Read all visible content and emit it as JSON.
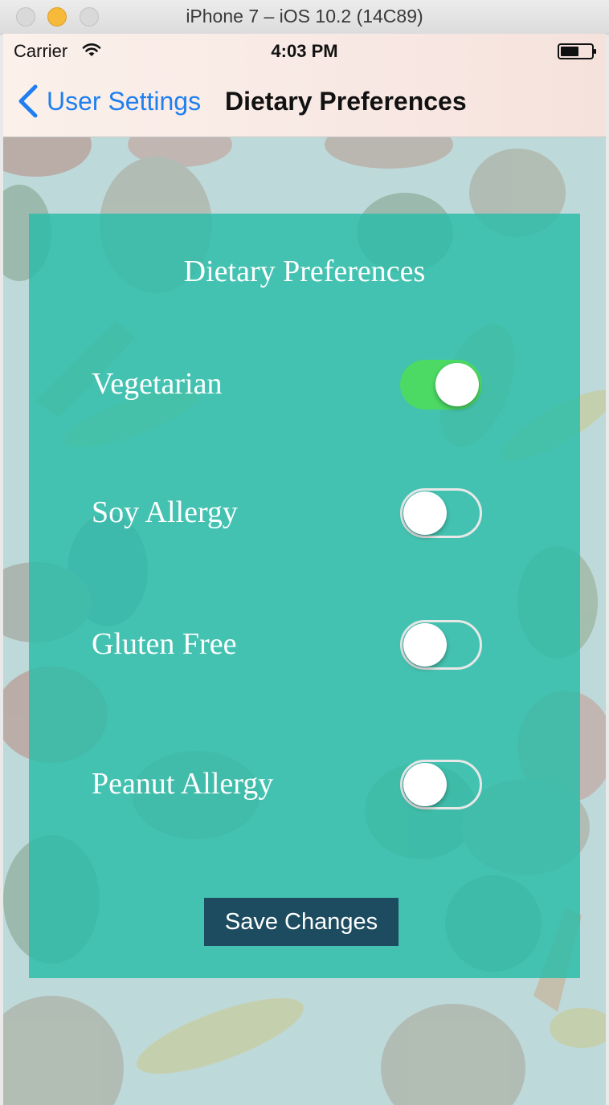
{
  "window": {
    "title": "iPhone 7 – iOS 10.2 (14C89)"
  },
  "status_bar": {
    "carrier": "Carrier",
    "time": "4:03 PM",
    "wifi_icon": "wifi-icon",
    "battery_icon": "battery-icon"
  },
  "nav": {
    "back_label": "User Settings",
    "title": "Dietary Preferences",
    "back_icon": "chevron-left-icon"
  },
  "card": {
    "title": "Dietary Preferences",
    "preferences": [
      {
        "label": "Vegetarian",
        "enabled": true
      },
      {
        "label": "Soy Allergy",
        "enabled": false
      },
      {
        "label": "Gluten Free",
        "enabled": false
      },
      {
        "label": "Peanut Allergy",
        "enabled": false
      }
    ],
    "save_label": "Save Changes"
  },
  "colors": {
    "accent": "#1f7ff0",
    "card": "#2abda8",
    "toggle_on": "#4cd964",
    "save_button": "#1d4c60"
  }
}
